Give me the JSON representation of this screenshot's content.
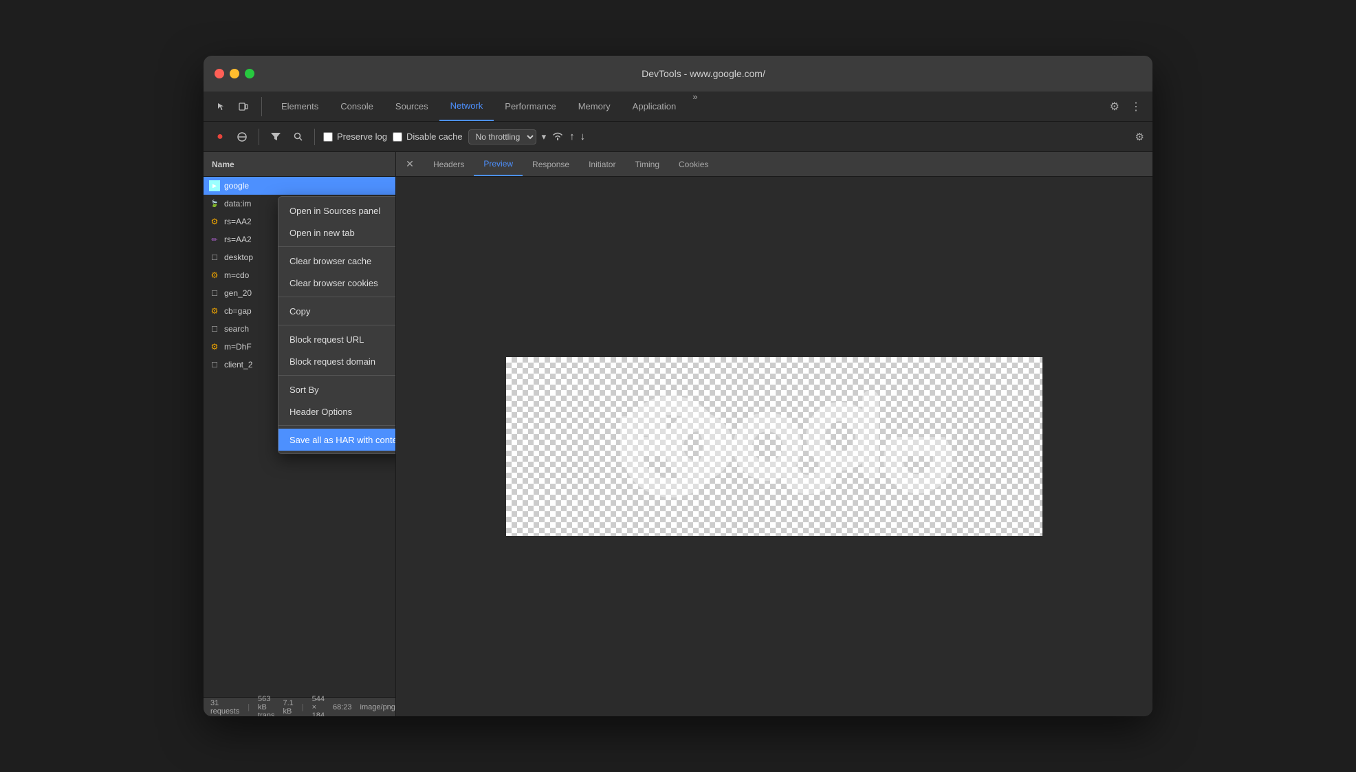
{
  "window": {
    "title": "DevTools - www.google.com/"
  },
  "traffic_lights": {
    "red": "close",
    "yellow": "minimize",
    "green": "maximize"
  },
  "nav": {
    "tabs": [
      {
        "id": "elements",
        "label": "Elements",
        "active": false
      },
      {
        "id": "console",
        "label": "Console",
        "active": false
      },
      {
        "id": "sources",
        "label": "Sources",
        "active": false
      },
      {
        "id": "network",
        "label": "Network",
        "active": true
      },
      {
        "id": "performance",
        "label": "Performance",
        "active": false
      },
      {
        "id": "memory",
        "label": "Memory",
        "active": false
      },
      {
        "id": "application",
        "label": "Application",
        "active": false
      }
    ]
  },
  "toolbar": {
    "preserve_log_label": "Preserve log",
    "disable_cache_label": "Disable cache",
    "throttle_label": "No throttling"
  },
  "column_header": {
    "name": "Name"
  },
  "request_list": [
    {
      "id": 1,
      "icon": "blue-rect",
      "icon_text": "►",
      "name": "google",
      "selected": true
    },
    {
      "id": 2,
      "icon": "leaf",
      "icon_text": "🍃",
      "name": "data:im",
      "selected": false
    },
    {
      "id": 3,
      "icon": "gear-small",
      "icon_text": "⚙",
      "name": "rs=AA2",
      "selected": false
    },
    {
      "id": 4,
      "icon": "pencil",
      "icon_text": "✏",
      "name": "rs=AA2",
      "selected": false
    },
    {
      "id": 5,
      "icon": "file",
      "icon_text": "□",
      "name": "desktop",
      "selected": false
    },
    {
      "id": 6,
      "icon": "gear-small",
      "icon_text": "⚙",
      "name": "m=cdo",
      "selected": false
    },
    {
      "id": 7,
      "icon": "file",
      "icon_text": "□",
      "name": "gen_20",
      "selected": false
    },
    {
      "id": 8,
      "icon": "gear-small",
      "icon_text": "⚙",
      "name": "cb=gap",
      "selected": false
    },
    {
      "id": 9,
      "icon": "file",
      "icon_text": "□",
      "name": "search",
      "selected": false
    },
    {
      "id": 10,
      "icon": "gear-small",
      "icon_text": "⚙",
      "name": "m=DhF",
      "selected": false
    },
    {
      "id": 11,
      "icon": "file",
      "icon_text": "□",
      "name": "client_2",
      "selected": false
    }
  ],
  "status_bar": {
    "requests": "31 requests",
    "transferred": "563 kB trans",
    "size": "7.1 kB",
    "dimensions": "544 × 184",
    "time": "68:23",
    "type": "image/png"
  },
  "detail_tabs": {
    "items": [
      {
        "id": "headers",
        "label": "Headers",
        "active": false
      },
      {
        "id": "preview",
        "label": "Preview",
        "active": true
      },
      {
        "id": "response",
        "label": "Response",
        "active": false
      },
      {
        "id": "initiator",
        "label": "Initiator",
        "active": false
      },
      {
        "id": "timing",
        "label": "Timing",
        "active": false
      },
      {
        "id": "cookies",
        "label": "Cookies",
        "active": false
      }
    ]
  },
  "context_menu": {
    "items": [
      {
        "id": "open-sources",
        "label": "Open in Sources panel",
        "has_separator_after": false,
        "has_arrow": false,
        "highlighted": false
      },
      {
        "id": "open-new-tab",
        "label": "Open in new tab",
        "has_separator_after": true,
        "has_arrow": false,
        "highlighted": false
      },
      {
        "id": "clear-cache",
        "label": "Clear browser cache",
        "has_separator_after": false,
        "has_arrow": false,
        "highlighted": false
      },
      {
        "id": "clear-cookies",
        "label": "Clear browser cookies",
        "has_separator_after": true,
        "has_arrow": false,
        "highlighted": false
      },
      {
        "id": "copy",
        "label": "Copy",
        "has_separator_after": true,
        "has_arrow": true,
        "highlighted": false
      },
      {
        "id": "block-url",
        "label": "Block request URL",
        "has_separator_after": false,
        "has_arrow": false,
        "highlighted": false
      },
      {
        "id": "block-domain",
        "label": "Block request domain",
        "has_separator_after": true,
        "has_arrow": false,
        "highlighted": false
      },
      {
        "id": "sort-by",
        "label": "Sort By",
        "has_separator_after": false,
        "has_arrow": true,
        "highlighted": false
      },
      {
        "id": "header-options",
        "label": "Header Options",
        "has_separator_after": true,
        "has_arrow": true,
        "highlighted": false
      },
      {
        "id": "save-har",
        "label": "Save all as HAR with content",
        "has_separator_after": false,
        "has_arrow": false,
        "highlighted": true
      }
    ]
  }
}
